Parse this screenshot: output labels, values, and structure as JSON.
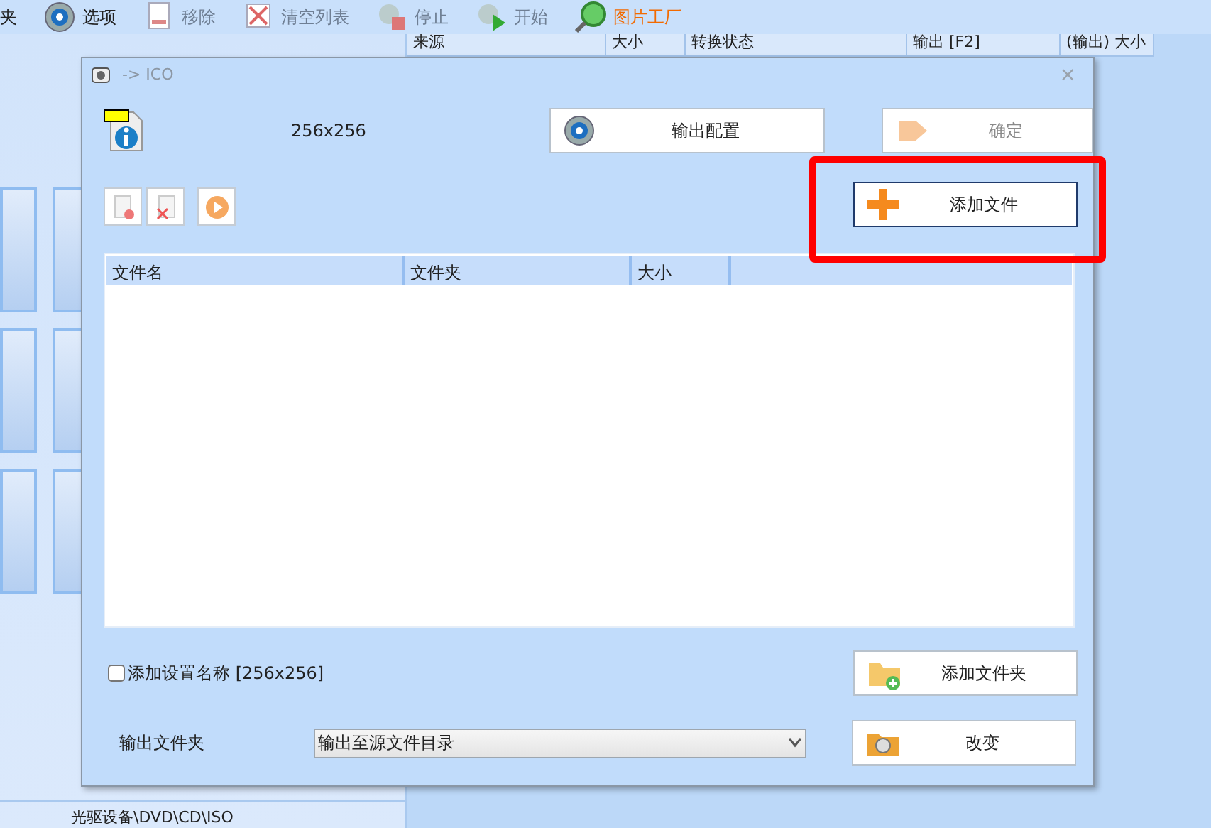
{
  "app_toolbar": [
    {
      "label": "夹",
      "disabled": false,
      "highlighted": false
    },
    {
      "label": "选项",
      "disabled": false,
      "highlighted": false
    },
    {
      "label": "移除",
      "disabled": true,
      "highlighted": false
    },
    {
      "label": "清空列表",
      "disabled": true,
      "highlighted": false
    },
    {
      "label": "停止",
      "disabled": true,
      "highlighted": false
    },
    {
      "label": "开始",
      "disabled": true,
      "highlighted": false
    },
    {
      "label": "图片工厂",
      "disabled": false,
      "highlighted": true
    }
  ],
  "task_columns": [
    "来源",
    "大小",
    "转换状态",
    "输出 [F2]",
    "(输出) 大小"
  ],
  "side_panel": {
    "footer": "光驱设备\\DVD\\CD\\ISO"
  },
  "dialog": {
    "title": "-> ICO",
    "close": "×",
    "preset_size": "256x256",
    "config_button": "输出配置",
    "ok_button": {
      "label": "确定",
      "disabled": true
    },
    "add_file_button": {
      "label": "添加文件",
      "focused": true
    },
    "tool_buttons": [
      {
        "kind": "remove"
      },
      {
        "kind": "delete"
      },
      {
        "kind": "play"
      }
    ],
    "file_columns": [
      "文件名",
      "文件夹",
      "大小"
    ],
    "name_option": {
      "label": "添加设置名称 [256x256]",
      "checked": false
    },
    "add_folder_button": "添加文件夹",
    "output_folder": {
      "label": "输出文件夹",
      "value": "输出至源文件目录"
    },
    "change_button": "改变"
  },
  "annotation": {
    "kind": "rectangle"
  }
}
